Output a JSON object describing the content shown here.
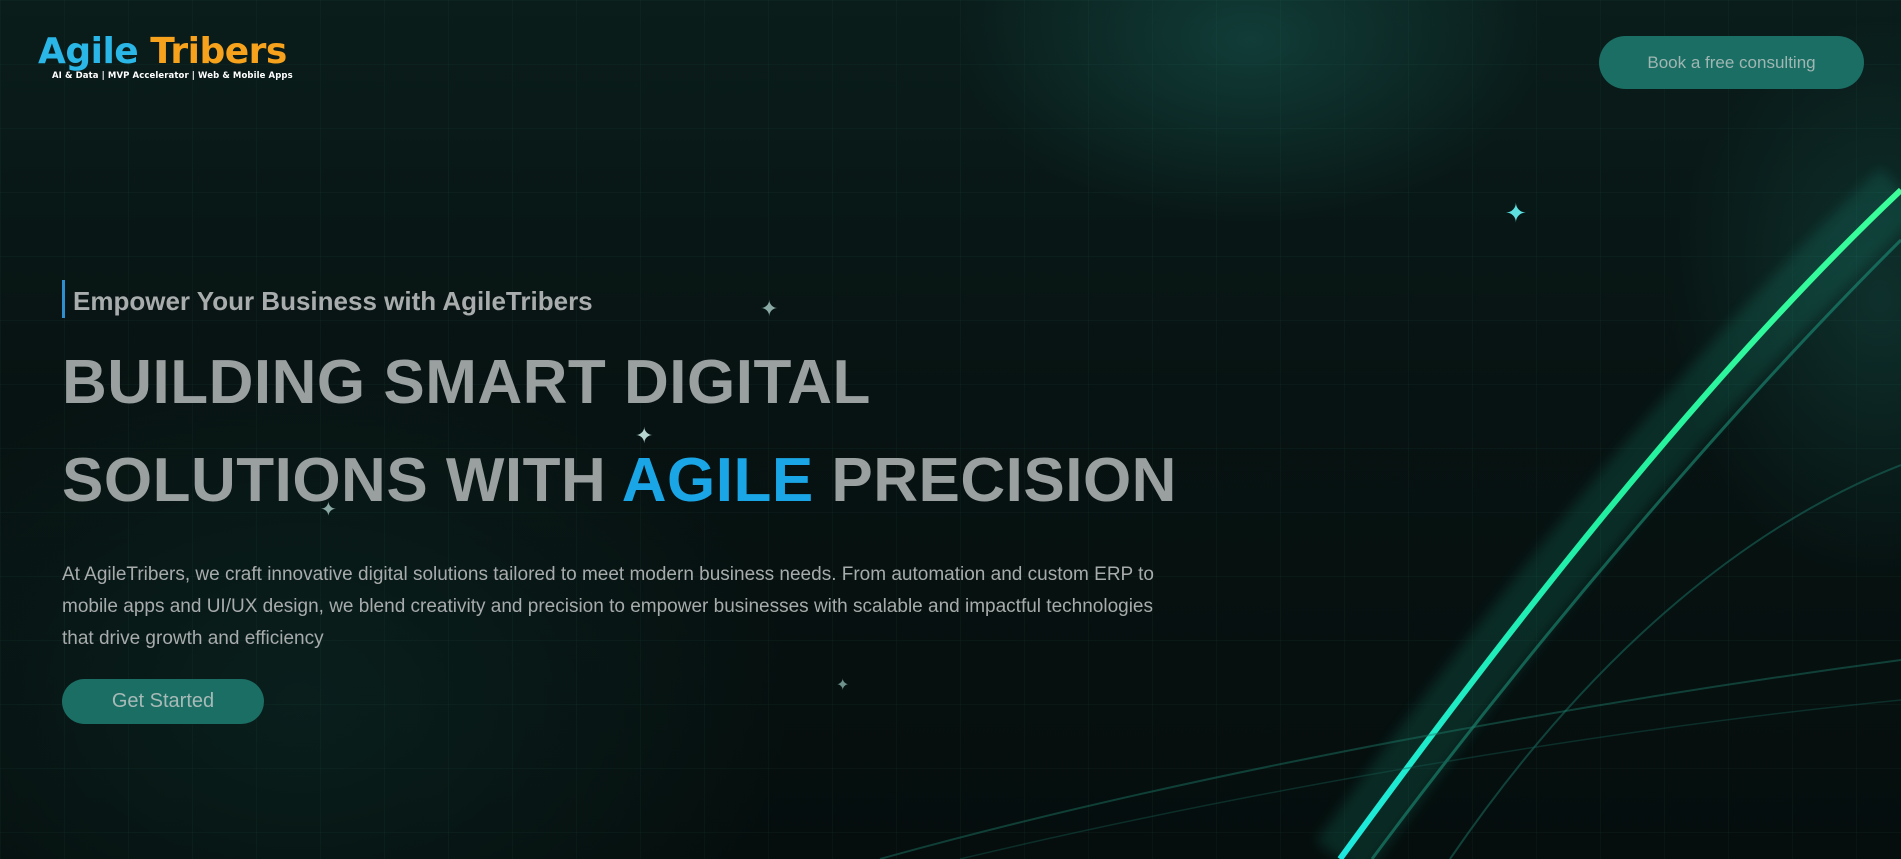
{
  "header": {
    "logo_word1": "Agile",
    "logo_word2": "Tribers",
    "tagline": "AI & Data | MVP Accelerator | Web & Mobile Apps",
    "cta_label": "Book a free consulting"
  },
  "hero": {
    "eyebrow": "Empower Your Business with AgileTribers",
    "headline_line1": "BUILDING SMART DIGITAL",
    "headline_line2_pre": "SOLUTIONS WITH ",
    "headline_line2_accent": "AGILE",
    "headline_line2_post": " PRECISION",
    "description": "At AgileTribers, we craft innovative digital solutions tailored to meet modern business needs. From automation and custom ERP to mobile apps and UI/UX design, we blend creativity and precision to empower businesses with scalable and impactful technologies that drive growth and efficiency",
    "cta_label": "Get Started"
  },
  "colors": {
    "logo_agile": "#2ab6e6",
    "logo_tribers": "#f7a21c",
    "accent": "#1aa6e6",
    "button_bg": "#1b6e64",
    "beam_bright": "#22f0a0"
  },
  "icons": {
    "sparkle": "sparkle-icon"
  }
}
